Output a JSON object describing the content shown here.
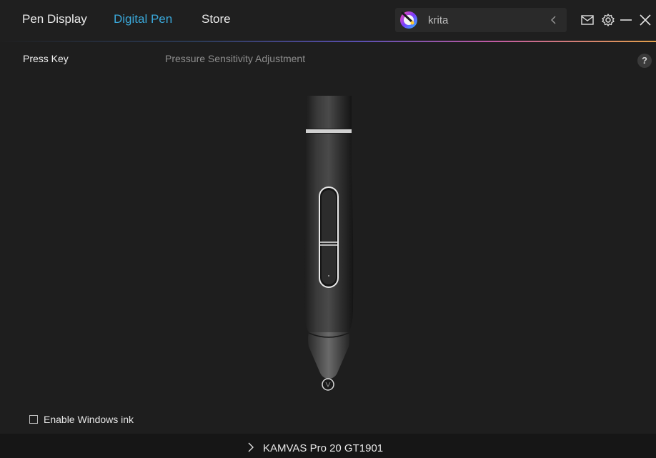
{
  "nav": {
    "tabs": [
      {
        "label": "Pen Display",
        "active": false
      },
      {
        "label": "Digital Pen",
        "active": true
      },
      {
        "label": "Store",
        "active": false
      }
    ]
  },
  "search": {
    "value": "krita",
    "app_icon": "krita-app-icon"
  },
  "window_controls": {
    "icons": [
      "mail-icon",
      "gear-icon",
      "minimize-icon",
      "close-icon"
    ]
  },
  "subtabs": [
    {
      "label": "Press Key",
      "active": true
    },
    {
      "label": "Pressure Sensitivity Adjustment",
      "active": false
    }
  ],
  "help": {
    "label": "?"
  },
  "footer": {
    "windows_ink": {
      "label": "Enable Windows ink",
      "checked": false
    }
  },
  "device": {
    "name": "KAMVAS Pro 20 GT1901"
  },
  "colors": {
    "accent": "#3aa7d8",
    "background": "#1e1e1e",
    "footer": "#161616"
  }
}
